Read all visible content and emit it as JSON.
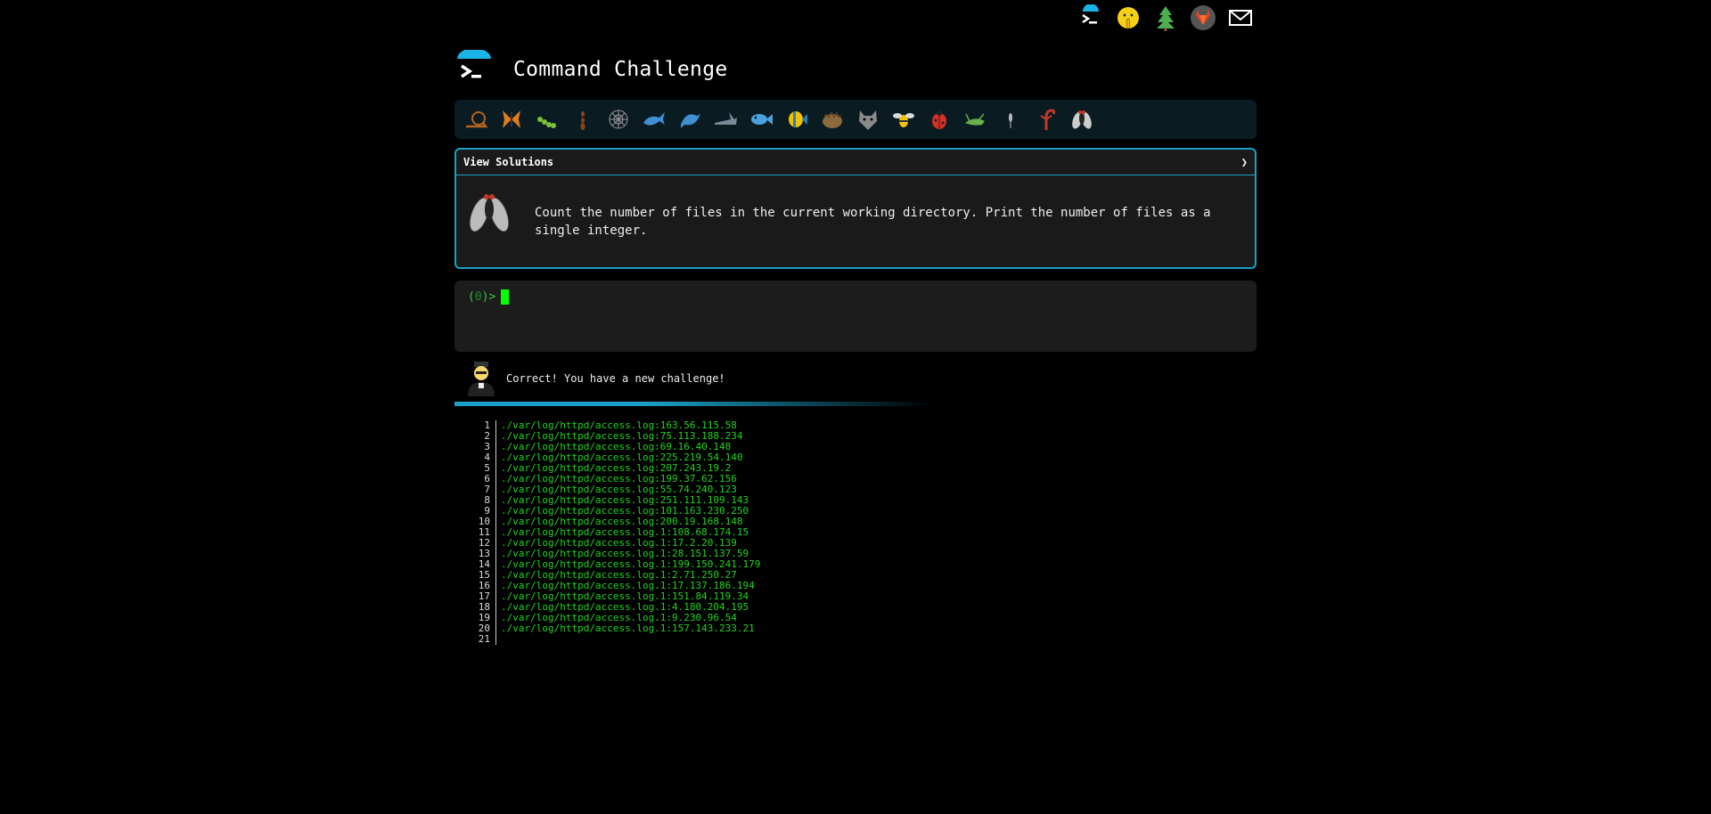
{
  "top_icons": [
    {
      "name": "terminal-logo-icon"
    },
    {
      "name": "shush-face-icon"
    },
    {
      "name": "tree-icon"
    },
    {
      "name": "gitlab-icon"
    },
    {
      "name": "mail-icon"
    }
  ],
  "brand": {
    "title": "Command Challenge"
  },
  "challenges": [
    {
      "name": "snail-icon",
      "color": "#b5651d"
    },
    {
      "name": "butterfly-icon",
      "color": "#e07b1f"
    },
    {
      "name": "caterpillar-icon",
      "color": "#7bbf3a"
    },
    {
      "name": "ant-icon",
      "color": "#8b4513"
    },
    {
      "name": "spiderweb-icon",
      "color": "#999999"
    },
    {
      "name": "whale-icon",
      "color": "#3f8fd2"
    },
    {
      "name": "dolphin-icon",
      "color": "#3f8fd2"
    },
    {
      "name": "shark-icon",
      "color": "#7a8a99"
    },
    {
      "name": "fish-icon",
      "color": "#4aa3df"
    },
    {
      "name": "tropical-fish-icon",
      "color": "#f2c200"
    },
    {
      "name": "hedgehog-icon",
      "color": "#8b6b3d"
    },
    {
      "name": "wolf-icon",
      "color": "#8a8a8a"
    },
    {
      "name": "bee-icon",
      "color": "#f2c200"
    },
    {
      "name": "ladybug-icon",
      "color": "#d93025"
    },
    {
      "name": "cricket-icon",
      "color": "#6ab04c"
    },
    {
      "name": "mosquito-icon",
      "color": "#bbbbbb"
    },
    {
      "name": "scorpion-icon",
      "color": "#c0392b"
    },
    {
      "name": "fly-icon",
      "color": "#cccccc"
    }
  ],
  "solutions": {
    "label": "View Solutions",
    "chevron": "❯"
  },
  "challenge_description": "Count the number of files in the current working directory. Print the number of files as a single integer.",
  "terminal": {
    "prompt_open": "(",
    "prompt_count": "0",
    "prompt_close": ")>"
  },
  "feedback": {
    "text": "Correct! You have a new challenge!"
  },
  "output_lines": [
    "./var/log/httpd/access.log:163.56.115.58",
    "./var/log/httpd/access.log:75.113.188.234",
    "./var/log/httpd/access.log:69.16.40.148",
    "./var/log/httpd/access.log:225.219.54.140",
    "./var/log/httpd/access.log:207.243.19.2",
    "./var/log/httpd/access.log:199.37.62.156",
    "./var/log/httpd/access.log:55.74.240.123",
    "./var/log/httpd/access.log:251.111.109.143",
    "./var/log/httpd/access.log:101.163.230.250",
    "./var/log/httpd/access.log:200.19.168.148",
    "./var/log/httpd/access.log.1:108.68.174.15",
    "./var/log/httpd/access.log.1:17.2.20.139",
    "./var/log/httpd/access.log.1:28.151.137.59",
    "./var/log/httpd/access.log.1:199.150.241.179",
    "./var/log/httpd/access.log.1:2.71.250.27",
    "./var/log/httpd/access.log.1:17.137.186.194",
    "./var/log/httpd/access.log.1:151.84.119.34",
    "./var/log/httpd/access.log.1:4.180.204.195",
    "./var/log/httpd/access.log.1:9.230.96.54",
    "./var/log/httpd/access.log.1:157.143.233.21",
    ""
  ]
}
